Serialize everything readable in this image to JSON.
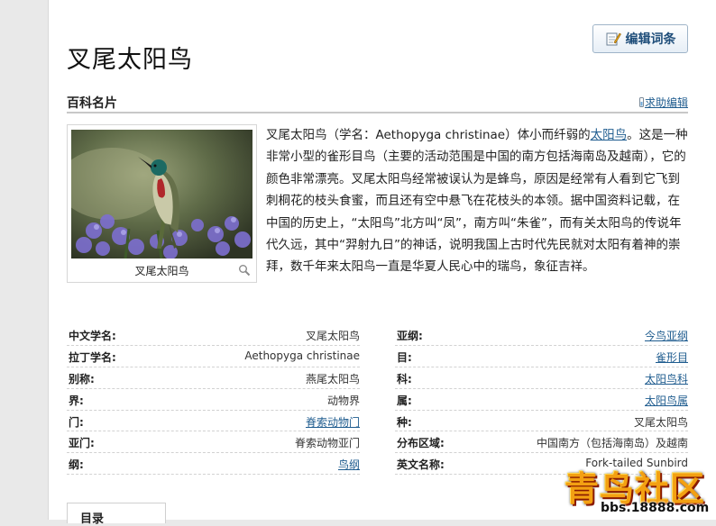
{
  "page": {
    "title": "叉尾太阳鸟",
    "edit_button": "编辑词条"
  },
  "card": {
    "header": "百科名片",
    "help_link": "求助编辑",
    "image_caption": "叉尾太阳鸟",
    "intro": {
      "part1": "叉尾太阳鸟（学名：Aethopyga christinae）体小而纤弱的",
      "link": "太阳鸟",
      "part2": "。这是一种非常小型的雀形目鸟（主要的活动范围是中国的南方包括海南岛及越南），它的颜色非常漂亮。叉尾太阳鸟经常被误认为是蜂鸟，原因是经常有人看到它飞到刺桐花的枝头食蜜，而且还有空中悬飞在花枝头的本领。据中国资料记载，在中国的历史上，“太阳鸟”北方叫“凤”，南方叫“朱雀”，而有关太阳鸟的传说年代久远，其中“羿射九日”的神话，说明我国上古时代先民就对太阳有着神的崇拜，数千年来太阳鸟一直是华夏人民心中的瑞鸟，象征吉祥。"
    }
  },
  "info_left": [
    {
      "label": "中文学名:",
      "value": "叉尾太阳鸟",
      "link": false
    },
    {
      "label": "拉丁学名:",
      "value": "Aethopyga christinae",
      "link": false
    },
    {
      "label": "别称:",
      "value": "燕尾太阳鸟",
      "link": false
    },
    {
      "label": "界:",
      "value": "动物界",
      "link": false
    },
    {
      "label": "门:",
      "value": "脊索动物门",
      "link": true
    },
    {
      "label": "亚门:",
      "value": "脊索动物亚门",
      "link": false
    },
    {
      "label": "纲:",
      "value": "鸟纲",
      "link": true
    }
  ],
  "info_right": [
    {
      "label": "亚纲:",
      "value": "今鸟亚纲",
      "link": true
    },
    {
      "label": "目:",
      "value": "雀形目",
      "link": true
    },
    {
      "label": "科:",
      "value": "太阳鸟科",
      "link": true
    },
    {
      "label": "属:",
      "value": "太阳鸟属",
      "link": true
    },
    {
      "label": "种:",
      "value": "叉尾太阳鸟",
      "link": false
    },
    {
      "label": "分布区域:",
      "value": "中国南方（包括海南岛）及越南",
      "link": false
    },
    {
      "label": "英文名称:",
      "value": "Fork-tailed Sunbird",
      "link": false
    }
  ],
  "toc": {
    "label": "目录"
  },
  "watermark": {
    "big": "青鸟社区",
    "small": "bbs.18888.com"
  },
  "colors": {
    "link": "#1f5c8f",
    "watermark": "#f3a012"
  }
}
